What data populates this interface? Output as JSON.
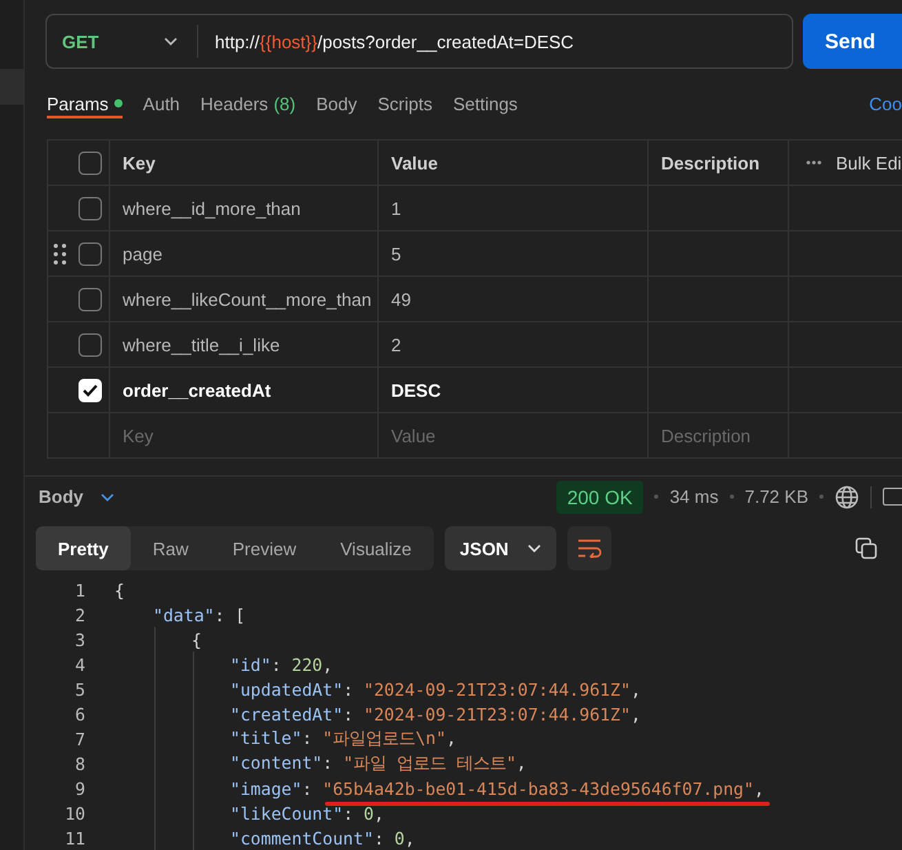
{
  "request": {
    "method": "GET",
    "url": [
      {
        "kind": "plain",
        "text": "http://"
      },
      {
        "kind": "variable",
        "text": "{{host}}"
      },
      {
        "kind": "plain",
        "text": "/posts?order__createdAt=DESC"
      }
    ],
    "send": "Send"
  },
  "tabs": [
    {
      "label": "Params",
      "selected": true,
      "dot": true
    },
    {
      "label": "Auth",
      "selected": false,
      "dot": false
    },
    {
      "label": "Headers",
      "count": "(8)",
      "selected": false,
      "dot": false
    },
    {
      "label": "Body",
      "selected": false,
      "dot": false
    },
    {
      "label": "Scripts",
      "selected": false,
      "dot": false
    },
    {
      "label": "Settings",
      "selected": false,
      "dot": false
    }
  ],
  "cookies_link": "Coo",
  "params": {
    "columns": [
      "Key",
      "Value",
      "Description"
    ],
    "bulk_edit": "Bulk Edi",
    "header_checked": false,
    "rows": [
      {
        "key": "where__id_more_than",
        "value": "1",
        "checked": false,
        "drag_handle": false
      },
      {
        "key": "page",
        "value": "5",
        "checked": false,
        "drag_handle": true
      },
      {
        "key": "where__likeCount__more_than",
        "value": "49",
        "checked": false,
        "drag_handle": false
      },
      {
        "key": "where__title__i_like",
        "value": "2",
        "checked": false,
        "drag_handle": false
      },
      {
        "key": "order__createdAt",
        "value": "DESC",
        "checked": true,
        "drag_handle": false
      }
    ],
    "new_row": {
      "key_placeholder": "Key",
      "value_placeholder": "Value",
      "description_placeholder": "Description"
    }
  },
  "response": {
    "section": "Body",
    "status": "200 OK",
    "time": "34 ms",
    "size": "7.72 KB",
    "views": [
      {
        "label": "Pretty",
        "selected": true
      },
      {
        "label": "Raw",
        "selected": false
      },
      {
        "label": "Preview",
        "selected": false
      },
      {
        "label": "Visualize",
        "selected": false
      }
    ],
    "format": "JSON",
    "code": [
      {
        "number": "1",
        "tokens": [
          {
            "kind": "punct",
            "text": "{"
          }
        ],
        "children": [
          {
            "number": "2",
            "tokens": [
              {
                "kind": "key",
                "text": "\"data\""
              },
              {
                "kind": "punct",
                "text": ": ["
              }
            ],
            "children": [
              {
                "number": "3",
                "tokens": [
                  {
                    "kind": "punct",
                    "text": "{"
                  }
                ],
                "children": [
                  {
                    "number": "4",
                    "tokens": [
                      {
                        "kind": "key",
                        "text": "\"id\""
                      },
                      {
                        "kind": "punct",
                        "text": ": "
                      },
                      {
                        "kind": "number",
                        "text": "220"
                      },
                      {
                        "kind": "punct",
                        "text": ","
                      }
                    ]
                  },
                  {
                    "number": "5",
                    "tokens": [
                      {
                        "kind": "key",
                        "text": "\"updatedAt\""
                      },
                      {
                        "kind": "punct",
                        "text": ": "
                      },
                      {
                        "kind": "string",
                        "text": "\"2024-09-21T23:07:44.961Z\""
                      },
                      {
                        "kind": "punct",
                        "text": ","
                      }
                    ]
                  },
                  {
                    "number": "6",
                    "tokens": [
                      {
                        "kind": "key",
                        "text": "\"createdAt\""
                      },
                      {
                        "kind": "punct",
                        "text": ": "
                      },
                      {
                        "kind": "string",
                        "text": "\"2024-09-21T23:07:44.961Z\""
                      },
                      {
                        "kind": "punct",
                        "text": ","
                      }
                    ]
                  },
                  {
                    "number": "7",
                    "tokens": [
                      {
                        "kind": "key",
                        "text": "\"title\""
                      },
                      {
                        "kind": "punct",
                        "text": ": "
                      },
                      {
                        "kind": "string",
                        "text": "\"파일업로드\\n\""
                      },
                      {
                        "kind": "punct",
                        "text": ","
                      }
                    ]
                  },
                  {
                    "number": "8",
                    "tokens": [
                      {
                        "kind": "key",
                        "text": "\"content\""
                      },
                      {
                        "kind": "punct",
                        "text": ": "
                      },
                      {
                        "kind": "string",
                        "text": "\"파일 업로드 테스트\""
                      },
                      {
                        "kind": "punct",
                        "text": ","
                      }
                    ]
                  },
                  {
                    "number": "9",
                    "underline": true,
                    "tokens": [
                      {
                        "kind": "key",
                        "text": "\"image\""
                      },
                      {
                        "kind": "punct",
                        "text": ": "
                      },
                      {
                        "kind": "string",
                        "text": "\"65b4a42b-be01-415d-ba83-43de95646f07.png\""
                      },
                      {
                        "kind": "punct",
                        "text": ","
                      }
                    ]
                  },
                  {
                    "number": "10",
                    "tokens": [
                      {
                        "kind": "key",
                        "text": "\"likeCount\""
                      },
                      {
                        "kind": "punct",
                        "text": ": "
                      },
                      {
                        "kind": "number",
                        "text": "0"
                      },
                      {
                        "kind": "punct",
                        "text": ","
                      }
                    ]
                  },
                  {
                    "number": "11",
                    "tokens": [
                      {
                        "kind": "key",
                        "text": "\"commentCount\""
                      },
                      {
                        "kind": "punct",
                        "text": ": "
                      },
                      {
                        "kind": "number",
                        "text": "0"
                      },
                      {
                        "kind": "punct",
                        "text": ","
                      }
                    ]
                  }
                ]
              }
            ]
          }
        ]
      }
    ]
  }
}
